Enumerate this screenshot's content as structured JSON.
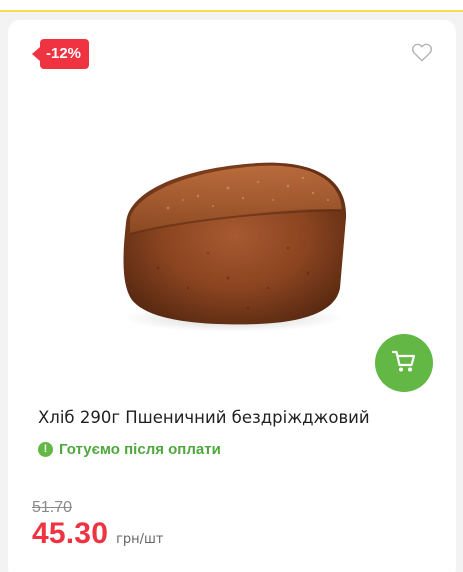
{
  "card": {
    "discount_badge": "-12%",
    "product_title": "Хліб 290г Пшеничний бездріжджовий",
    "status_icon": "!",
    "status_text": "Готуємо після оплати",
    "old_price": "51.70",
    "price": "45.30",
    "price_unit": "грн/шт"
  },
  "icons": {
    "favorite": "heart-outline-icon",
    "cart": "cart-icon",
    "status": "info-exclamation-icon"
  },
  "colors": {
    "accent_red": "#ef3340",
    "accent_green": "#63b745",
    "top_border_yellow": "#f4e04d"
  }
}
